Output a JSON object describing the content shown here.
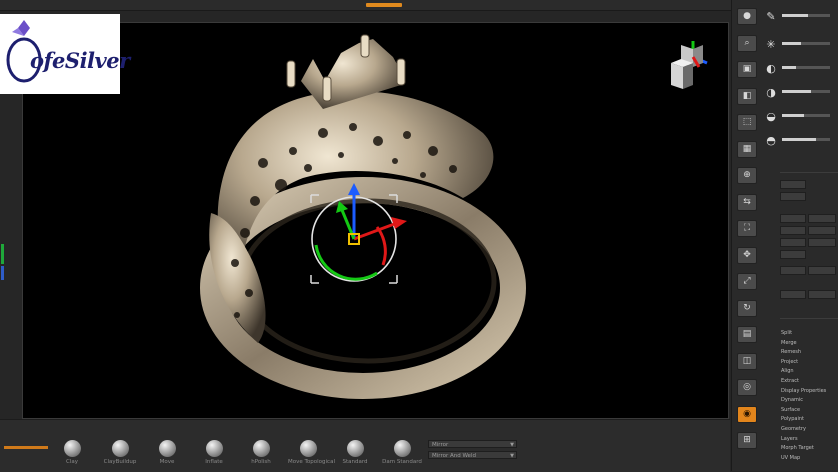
{
  "logo": {
    "text": "ofeSilver"
  },
  "viewport": {
    "colors": {
      "background": "#000000",
      "metal_light": "#ece0c8",
      "metal_mid": "#a89880",
      "metal_dark": "#4a4034"
    },
    "gizmo_colors": {
      "x": "#e01818",
      "y": "#14c814",
      "z": "#1c5cff",
      "center": "#f0c000"
    }
  },
  "brush_shelf": {
    "brushes": [
      {
        "label": "Clay"
      },
      {
        "label": "ClayBuildup"
      },
      {
        "label": "Move"
      },
      {
        "label": "Inflate"
      },
      {
        "label": "hPolish"
      },
      {
        "label": "Move Topological"
      },
      {
        "label": "Standard"
      },
      {
        "label": "Dam Standard"
      }
    ],
    "fields": [
      {
        "label": "Mirror"
      },
      {
        "label": "Mirror And Weld"
      }
    ]
  },
  "toolbar": {
    "buttons": [
      {
        "name": "sphere-tool",
        "glyph": "●",
        "label": ""
      },
      {
        "name": "zoom-tool",
        "glyph": "⌕",
        "label": ""
      },
      {
        "name": "actual-tool",
        "glyph": "▣",
        "label": ""
      },
      {
        "name": "aahalf-tool",
        "glyph": "◧",
        "label": ""
      },
      {
        "name": "persp-tool",
        "glyph": "⬚",
        "label": ""
      },
      {
        "name": "floor-tool",
        "glyph": "▦",
        "label": ""
      },
      {
        "name": "local-tool",
        "glyph": "⊕",
        "label": ""
      },
      {
        "name": "symmetry-tool",
        "glyph": "⇆",
        "label": ""
      },
      {
        "name": "frame-tool",
        "glyph": "⛶",
        "label": ""
      },
      {
        "name": "move-tool",
        "glyph": "✥",
        "label": ""
      },
      {
        "name": "scale-tool",
        "glyph": "⤢",
        "label": ""
      },
      {
        "name": "rotate-tool",
        "glyph": "↻",
        "label": ""
      },
      {
        "name": "polyf-tool",
        "glyph": "▤",
        "label": ""
      },
      {
        "name": "transp-tool",
        "glyph": "◫",
        "label": ""
      },
      {
        "name": "ghost-tool",
        "glyph": "◎",
        "label": ""
      },
      {
        "name": "solo-tool",
        "glyph": "◉",
        "label": ""
      },
      {
        "name": "xpose-tool",
        "glyph": "⊞",
        "label": ""
      }
    ],
    "active_index": 15
  },
  "palette": {
    "menu_items": [
      "Split",
      "Merge",
      "Remesh",
      "Project",
      "Align",
      "Extract",
      "Display Properties",
      "Dynamic",
      "Surface",
      "Polypaint",
      "Geometry",
      "Layers",
      "Morph Target",
      "UV Map"
    ]
  }
}
